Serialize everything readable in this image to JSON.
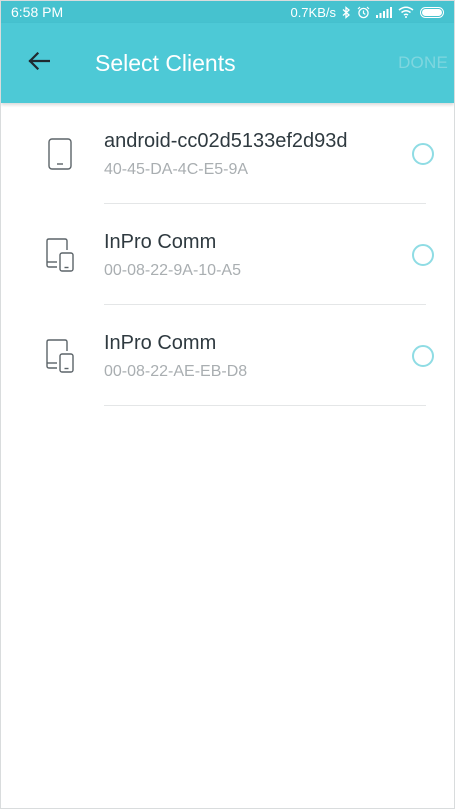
{
  "status_bar": {
    "time": "6:58 PM",
    "speed": "0.7KB/s"
  },
  "app_bar": {
    "title": "Select Clients",
    "done_label": "DONE"
  },
  "clients": [
    {
      "name": "android-cc02d5133ef2d93d",
      "mac": "40-45-DA-4C-E5-9A",
      "icon": "tablet-icon"
    },
    {
      "name": "InPro Comm",
      "mac": "00-08-22-9A-10-A5",
      "icon": "multi-device-icon"
    },
    {
      "name": "InPro Comm",
      "mac": "00-08-22-AE-EB-D8",
      "icon": "multi-device-icon"
    }
  ],
  "colors": {
    "status_bar": "#46c2cf",
    "app_bar": "#4dc9d6",
    "radio_border": "#8fdce4",
    "done_disabled": "#7fd6df"
  }
}
